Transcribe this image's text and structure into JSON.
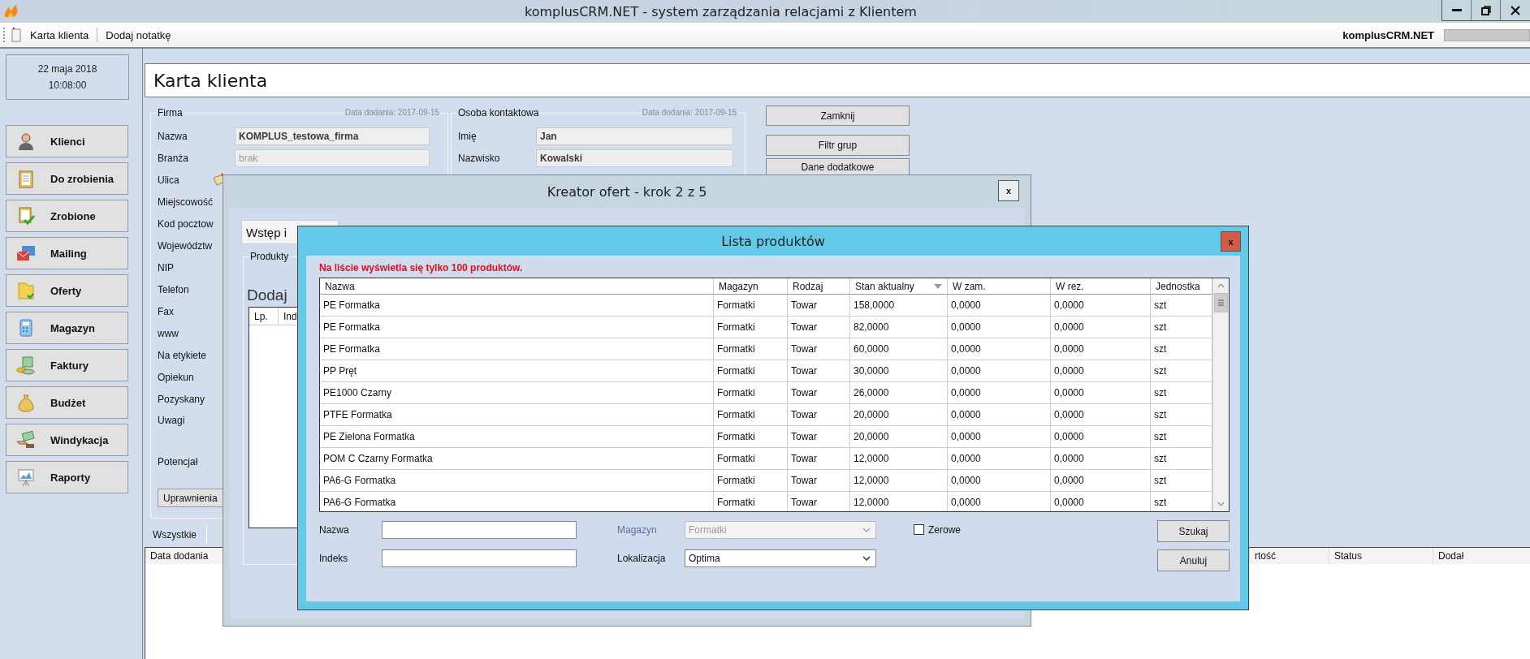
{
  "window": {
    "title": "komplusCRM.NET - system zarządzania relacjami z Klientem"
  },
  "toolbar": {
    "items": [
      "Karta klienta",
      "Dodaj notatkę"
    ],
    "brand": "komplusCRM.NET"
  },
  "clock": {
    "date": "22 maja 2018",
    "time": "10:08:00"
  },
  "sidebar": {
    "items": [
      {
        "label": "Klienci"
      },
      {
        "label": "Do zrobienia"
      },
      {
        "label": "Zrobione"
      },
      {
        "label": "Mailing"
      },
      {
        "label": "Oferty"
      },
      {
        "label": "Magazyn"
      },
      {
        "label": "Faktury"
      },
      {
        "label": "Budżet"
      },
      {
        "label": "Windykacja"
      },
      {
        "label": "Raporty"
      }
    ]
  },
  "page_title": "Karta klienta",
  "firma": {
    "title": "Firma",
    "added": "Data dodania: 2017-09-15",
    "fields": [
      {
        "kind": "text",
        "label": "Nazwa",
        "value": "KOMPLUS_testowa_firma"
      },
      {
        "kind": "text",
        "label": "Branża",
        "placeholder": "brak"
      },
      {
        "kind": "note",
        "label": "Ulica"
      },
      {
        "kind": "label",
        "label": "Miejscowość"
      },
      {
        "kind": "label",
        "label": "Kod pocztow"
      },
      {
        "kind": "label",
        "label": "Województw"
      },
      {
        "kind": "label",
        "label": "NIP"
      },
      {
        "kind": "label",
        "label": "Telefon"
      },
      {
        "kind": "label",
        "label": "Fax"
      },
      {
        "kind": "label",
        "label": "www"
      },
      {
        "kind": "label",
        "label": "Na etykiete"
      },
      {
        "kind": "label",
        "label": "Opiekun"
      },
      {
        "kind": "label",
        "label": "Pozyskany"
      },
      {
        "kind": "memo",
        "label": "Uwagi"
      },
      {
        "kind": "label",
        "label": "Potencjał"
      }
    ],
    "button": "Uprawnienia"
  },
  "osoba": {
    "title": "Osoba kontaktowa",
    "added": "Data dodania: 2017-09-15",
    "fields": [
      {
        "kind": "text",
        "label": "Imię",
        "value": "Jan"
      },
      {
        "kind": "text",
        "label": "Nazwisko",
        "value": "Kowalski"
      }
    ]
  },
  "actions": [
    "Zamknij",
    "Filtr grup",
    "Dane dodatkowe"
  ],
  "bottom": {
    "tabs": [
      {
        "label": "Wszystkie"
      }
    ],
    "columns": [
      "Data dodania",
      "rtość",
      "Status",
      "Dodał"
    ]
  },
  "offer_wizard": {
    "title": "Kreator ofert - krok 2 z 5",
    "close": "x",
    "tabs": [
      {
        "label": "Wstęp i"
      }
    ],
    "group": "Produkty",
    "heading": "Dodaj",
    "columns": [
      "Lp.",
      "Ind"
    ]
  },
  "product_list": {
    "title": "Lista produktów",
    "close": "x",
    "notice": "Na liście wyświetla się tylko 100 produktów.",
    "columns": [
      "Nazwa",
      "Magazyn",
      "Rodzaj",
      "Stan aktualny",
      "W zam.",
      "W rez.",
      "Jednostka"
    ],
    "rows": [
      [
        "PE Formatka",
        "Formatki",
        "Towar",
        "158,0000",
        "0,0000",
        "0,0000",
        "szt"
      ],
      [
        "PE Formatka",
        "Formatki",
        "Towar",
        "82,0000",
        "0,0000",
        "0,0000",
        "szt"
      ],
      [
        "PE Formatka",
        "Formatki",
        "Towar",
        "60,0000",
        "0,0000",
        "0,0000",
        "szt"
      ],
      [
        "PP Pręt",
        "Formatki",
        "Towar",
        "30,0000",
        "0,0000",
        "0,0000",
        "szt"
      ],
      [
        "PE1000 Czarny",
        "Formatki",
        "Towar",
        "26,0000",
        "0,0000",
        "0,0000",
        "szt"
      ],
      [
        "PTFE Formatka",
        "Formatki",
        "Towar",
        "20,0000",
        "0,0000",
        "0,0000",
        "szt"
      ],
      [
        "PE Zielona Formatka",
        "Formatki",
        "Towar",
        "20,0000",
        "0,0000",
        "0,0000",
        "szt"
      ],
      [
        "POM C Czarny Formatka",
        "Formatki",
        "Towar",
        "12,0000",
        "0,0000",
        "0,0000",
        "szt"
      ],
      [
        "PA6-G  Formatka",
        "Formatki",
        "Towar",
        "12,0000",
        "0,0000",
        "0,0000",
        "szt"
      ],
      [
        "PA6-G Formatka",
        "Formatki",
        "Towar",
        "12,0000",
        "0,0000",
        "0,0000",
        "szt"
      ]
    ],
    "filter_rows": [
      [
        {
          "kind": "text",
          "label": "Nazwa"
        },
        {
          "kind": "select",
          "label": "Magazyn",
          "value": "Formatki",
          "disabled": true
        },
        {
          "kind": "checkbox",
          "label": "Zerowe",
          "checked": false
        }
      ],
      [
        {
          "kind": "text",
          "label": "Indeks"
        },
        {
          "kind": "select",
          "label": "Lokalizacja",
          "value": "Optima",
          "disabled": false
        }
      ]
    ],
    "buttons": [
      "Szukaj",
      "Anuluj"
    ]
  }
}
